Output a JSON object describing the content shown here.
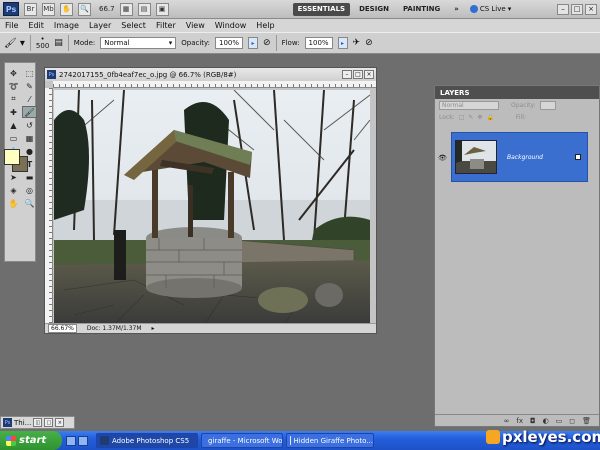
{
  "app": {
    "logo": "Ps",
    "zoom": "66.7"
  },
  "workspaces": {
    "essentials": "ESSENTIALS",
    "design": "DESIGN",
    "painting": "PAINTING",
    "more": "»",
    "cslive": "CS Live"
  },
  "menu": [
    "File",
    "Edit",
    "Image",
    "Layer",
    "Select",
    "Filter",
    "View",
    "Window",
    "Help"
  ],
  "options": {
    "brush_size": "500",
    "mode_label": "Mode:",
    "mode_value": "Normal",
    "opacity_label": "Opacity:",
    "opacity_value": "100%",
    "flow_label": "Flow:",
    "flow_value": "100%"
  },
  "document": {
    "title": "2742017155_0fb4eaf7ec_o.jpg @ 66.7% (RGB/8#)",
    "zoom": "66.67%",
    "doc_size": "Doc: 1.37M/1.37M"
  },
  "layers_panel": {
    "title": "LAYERS",
    "blend": "Normal",
    "opacity_label": "Opacity:",
    "lock_label": "Lock:",
    "fill_label": "Fill:",
    "layer_name": "Background"
  },
  "minimized_doc": "Thi...",
  "taskbar": {
    "start": "start",
    "tasks": [
      "Adobe Photoshop CS5",
      "giraffe - Microsoft Word",
      "Hidden Giraffe Photo..."
    ]
  },
  "watermark": "pxleyes.com",
  "colors": {
    "foreground": "#ffffc0",
    "background": "#7a7154",
    "layer_selected": "#3a6fd0",
    "taskbar": "#245edb"
  }
}
